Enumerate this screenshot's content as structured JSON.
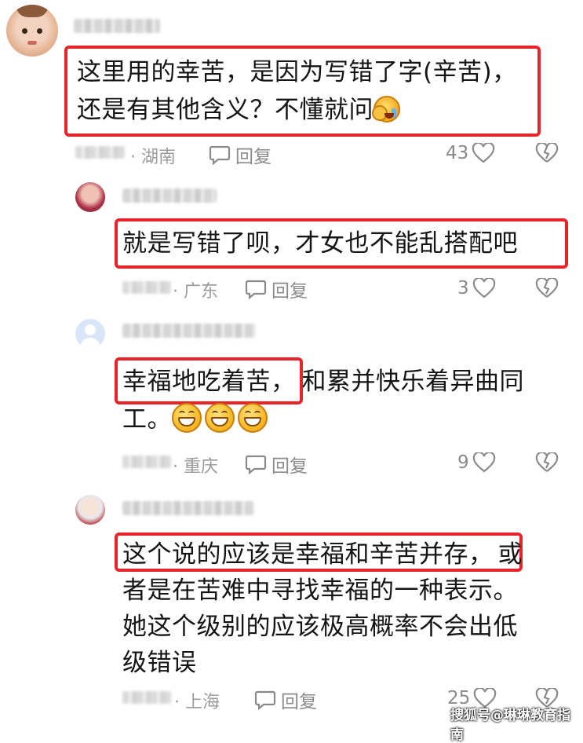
{
  "comments": [
    {
      "lines": [
        "这里用的幸苦，是因为写错了字(辛苦)，",
        "还是有其他含义？不懂就问"
      ],
      "location": "· 湖南",
      "reply_label": "回复",
      "likes": "43"
    },
    {
      "lines": [
        "就是写错了呗，才女也不能乱搭配吧"
      ],
      "location": "· 广东",
      "reply_label": "回复",
      "likes": "3"
    },
    {
      "lines_highlight": "幸福地吃着苦，",
      "lines_rest": "和累并快乐着异曲同",
      "line2": "工。",
      "location": "· 重庆",
      "reply_label": "回复",
      "likes": "9"
    },
    {
      "highlight": "这个说的应该是幸福和辛苦并存，",
      "rest": "或",
      "lines": [
        "者是在苦难中寻找幸福的一种表示。",
        "她这个级别的应该极高概率不会出低",
        "级错误"
      ],
      "location": "· 上海",
      "reply_label": "回复",
      "likes": "25"
    }
  ],
  "watermark": "搜狐号@琳琳教育指南",
  "icons": {
    "reply": "speech-bubble-icon",
    "like": "heart-outline-icon",
    "dislike": "broken-heart-icon",
    "emoji_cry": "crying-face-emoji",
    "emoji_grin": "grinning-face-emoji"
  },
  "colors": {
    "highlight_border": "#e8232a",
    "meta_text": "#9b9b9b"
  }
}
